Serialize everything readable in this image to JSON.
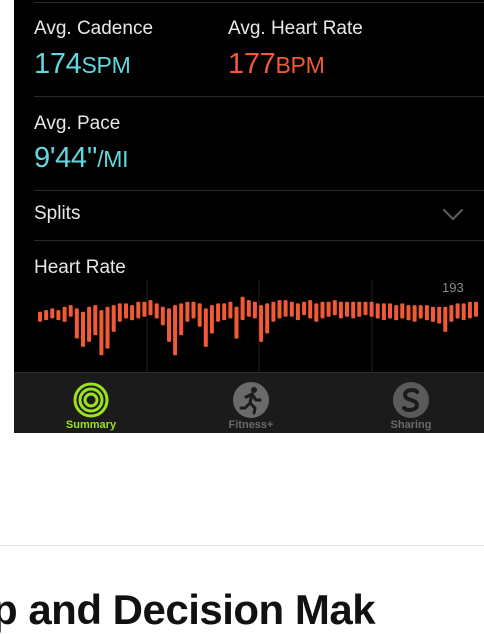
{
  "metrics": {
    "cadence": {
      "label": "Avg. Cadence",
      "value": "174",
      "unit": "SPM"
    },
    "heart_rate": {
      "label": "Avg. Heart Rate",
      "value": "177",
      "unit": "BPM"
    },
    "pace": {
      "label": "Avg. Pace",
      "value": "9'44''",
      "unit": "/MI"
    }
  },
  "splits": {
    "label": "Splits"
  },
  "heart_rate_chart": {
    "label": "Heart Rate",
    "max_label": "193",
    "color": "#f25a35",
    "samples": [
      [
        170,
        176
      ],
      [
        171,
        177
      ],
      [
        172,
        178
      ],
      [
        171,
        177
      ],
      [
        170,
        179
      ],
      [
        173,
        180
      ],
      [
        160,
        178
      ],
      [
        155,
        176
      ],
      [
        158,
        179
      ],
      [
        162,
        180
      ],
      [
        150,
        177
      ],
      [
        154,
        179
      ],
      [
        164,
        180
      ],
      [
        170,
        181
      ],
      [
        172,
        181
      ],
      [
        171,
        180
      ],
      [
        172,
        182
      ],
      [
        173,
        182
      ],
      [
        174,
        183
      ],
      [
        172,
        181
      ],
      [
        168,
        179
      ],
      [
        158,
        178
      ],
      [
        150,
        180
      ],
      [
        162,
        181
      ],
      [
        170,
        182
      ],
      [
        172,
        182
      ],
      [
        167,
        181
      ],
      [
        155,
        178
      ],
      [
        163,
        180
      ],
      [
        170,
        181
      ],
      [
        171,
        181
      ],
      [
        172,
        182
      ],
      [
        160,
        179
      ],
      [
        171,
        185
      ],
      [
        173,
        183
      ],
      [
        172,
        182
      ],
      [
        158,
        180
      ],
      [
        163,
        181
      ],
      [
        170,
        182
      ],
      [
        172,
        183
      ],
      [
        173,
        183
      ],
      [
        173,
        182
      ],
      [
        171,
        181
      ],
      [
        174,
        182
      ],
      [
        172,
        183
      ],
      [
        170,
        181
      ],
      [
        172,
        182
      ],
      [
        173,
        182
      ],
      [
        174,
        183
      ],
      [
        172,
        182
      ],
      [
        173,
        182
      ],
      [
        172,
        182
      ],
      [
        173,
        182
      ],
      [
        174,
        182
      ],
      [
        173,
        182
      ],
      [
        172,
        181
      ],
      [
        171,
        181
      ],
      [
        172,
        181
      ],
      [
        171,
        180
      ],
      [
        172,
        181
      ],
      [
        171,
        180
      ],
      [
        170,
        180
      ],
      [
        172,
        180
      ],
      [
        171,
        180
      ],
      [
        170,
        179
      ],
      [
        169,
        179
      ],
      [
        164,
        179
      ],
      [
        170,
        180
      ],
      [
        172,
        181
      ],
      [
        171,
        181
      ],
      [
        172,
        182
      ],
      [
        173,
        182
      ]
    ]
  },
  "tabbar": {
    "tabs": [
      {
        "label": "Summary",
        "icon": "activity-rings-icon",
        "active": true,
        "color": "#9be21f"
      },
      {
        "label": "Fitness+",
        "icon": "running-figure-icon",
        "active": false,
        "color": "#6a6a6a"
      },
      {
        "label": "Sharing",
        "icon": "sharing-s-icon",
        "active": false,
        "color": "#6a6a6a"
      }
    ]
  },
  "article": {
    "heading": "p and Decision Mak"
  }
}
